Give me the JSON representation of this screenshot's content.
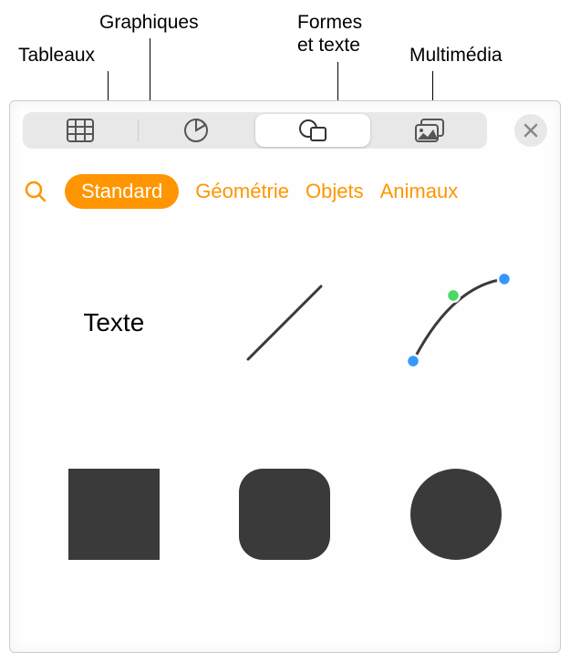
{
  "callouts": {
    "tableaux": "Tableaux",
    "graphiques": "Graphiques",
    "formes": "Formes\net texte",
    "multimedia": "Multimédia"
  },
  "toolbar": {
    "tables_icon": "tables",
    "charts_icon": "charts",
    "shapes_icon": "shapes",
    "media_icon": "media",
    "close_icon": "close"
  },
  "categories": {
    "search": "search",
    "items": [
      "Standard",
      "Géométrie",
      "Objets",
      "Animaux"
    ],
    "active_index": 0
  },
  "shapes": {
    "text_label": "Texte"
  },
  "colors": {
    "accent": "#ff9500",
    "shape_fill": "#3a3a3a"
  }
}
